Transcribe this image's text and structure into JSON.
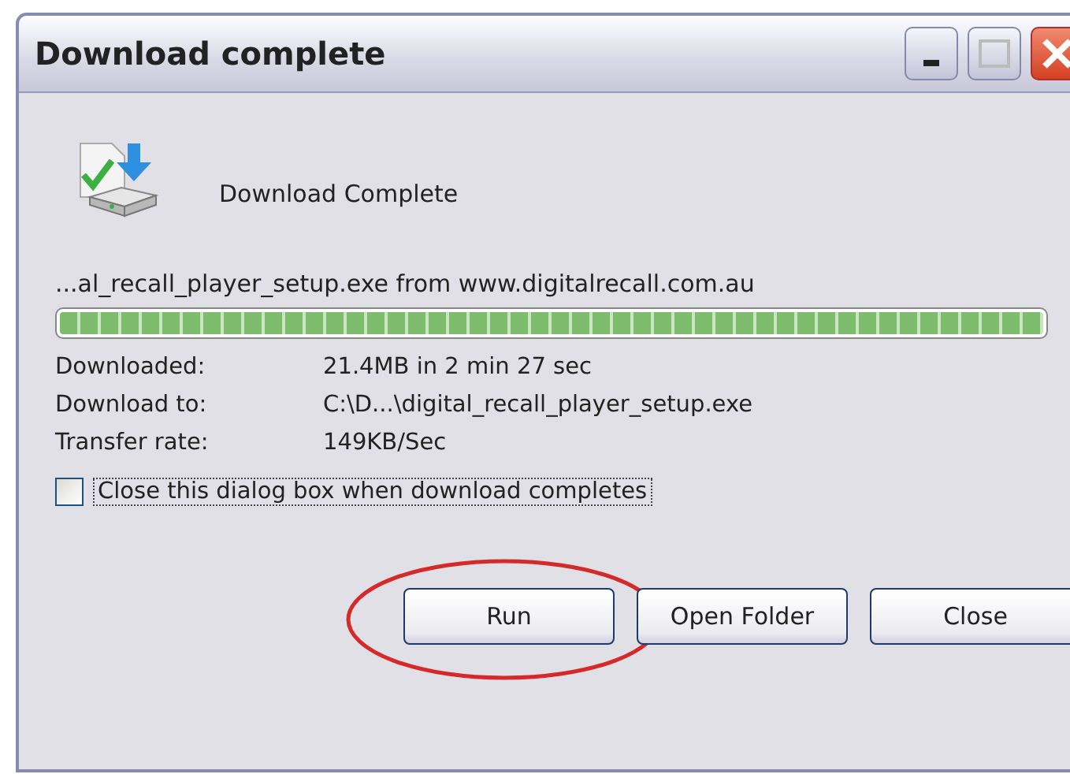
{
  "window": {
    "title": "Download complete"
  },
  "status": {
    "heading": "Download Complete"
  },
  "file_line": "...al_recall_player_setup.exe from www.digitalrecall.com.au",
  "progress": {
    "level": 1
  },
  "details": [
    {
      "label": "Downloaded:",
      "value": "21.4MB in 2 min 27 sec"
    },
    {
      "label": "Download to:",
      "value": "C:\\D...\\digital_recall_player_setup.exe"
    },
    {
      "label": "Transfer rate:",
      "value": "149KB/Sec"
    }
  ],
  "close_option": {
    "label": "Close this dialog box when download completes",
    "checked": false
  },
  "buttons": [
    {
      "label": "Run",
      "highlighted": true
    },
    {
      "label": "Open Folder",
      "highlighted": false
    },
    {
      "label": "Close",
      "highlighted": false
    }
  ]
}
